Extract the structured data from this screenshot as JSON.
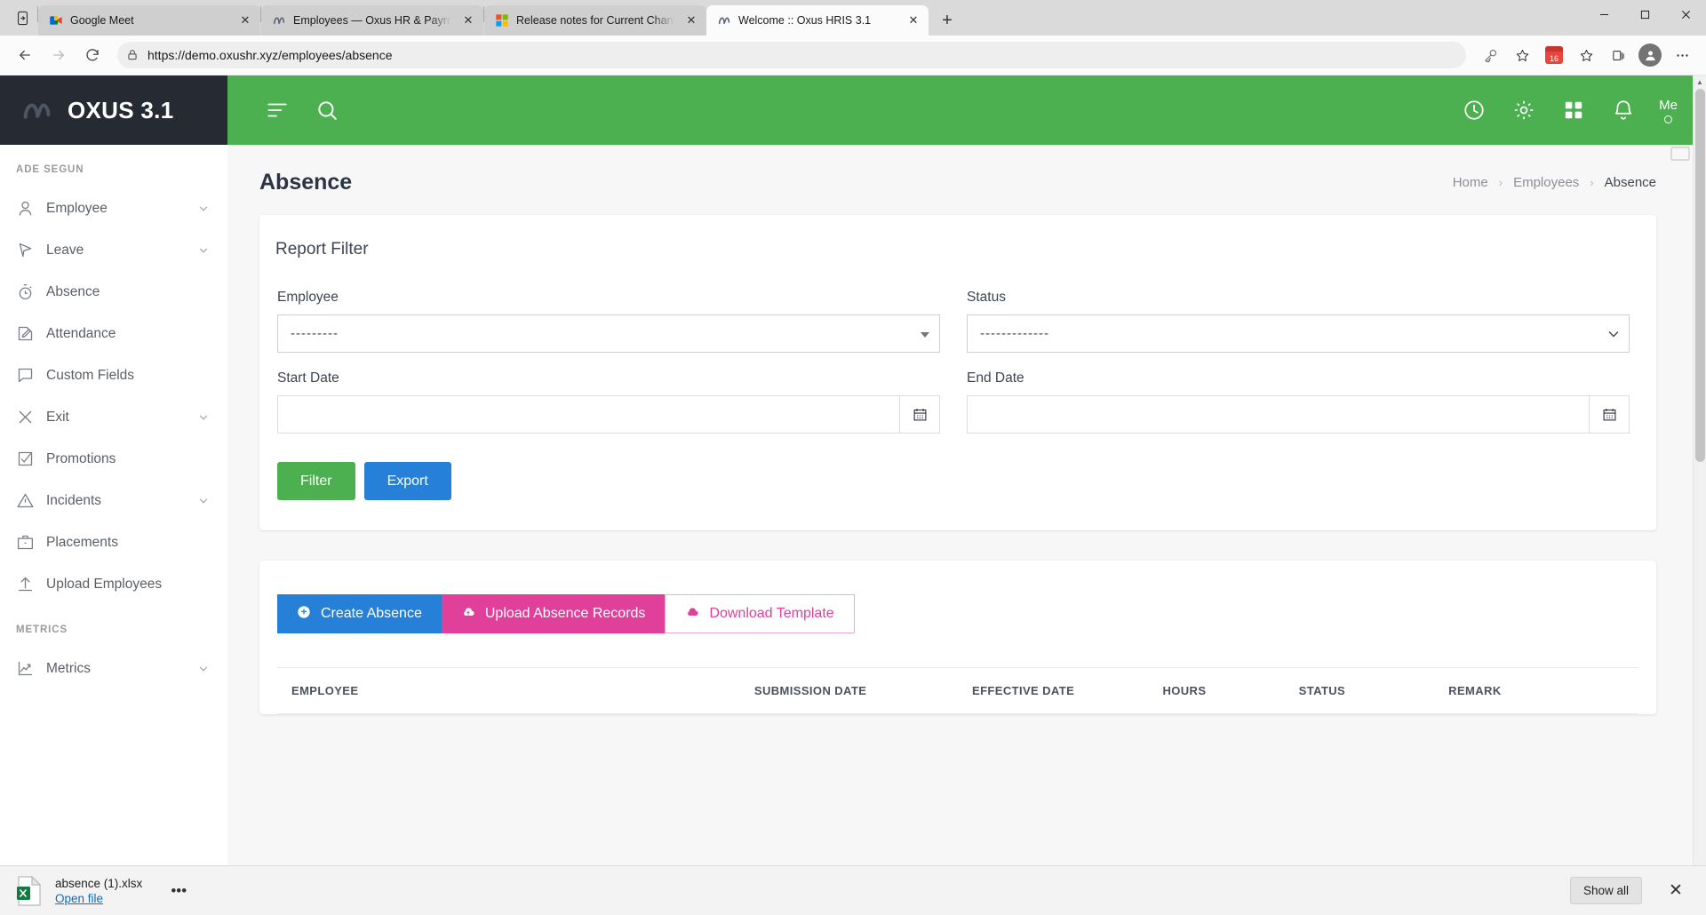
{
  "browser": {
    "tabs": [
      {
        "title": "Google Meet",
        "favicon": "meet-icon",
        "active": false
      },
      {
        "title": "Employees — Oxus HR & Payroll",
        "favicon": "oxus-icon",
        "active": false
      },
      {
        "title": "Release notes for Current Chann",
        "favicon": "microsoft-icon",
        "active": false
      },
      {
        "title": "Welcome :: Oxus HRIS 3.1",
        "favicon": "oxus-icon",
        "active": true
      }
    ],
    "new_tab_label": "+",
    "close_label": "✕",
    "window_controls": {
      "minimize": "minimize-icon",
      "maximize": "maximize-icon",
      "close": "close-icon"
    },
    "toolbar": {
      "back": "back-arrow-icon",
      "forward": "forward-arrow-icon",
      "reload": "reload-icon",
      "lock": "lock-icon",
      "url_scheme": "https://",
      "url_host": "demo.oxushr.xyz",
      "url_path": "/employees/absence",
      "url_full": "https://demo.oxushr.xyz/employees/absence",
      "icons": [
        "key-icon",
        "favorite-star-icon",
        "calendar-badge-icon",
        "collections-icon",
        "browser-essentials-icon",
        "profile-icon",
        "settings-more-icon"
      ],
      "calendar_badge_number": "16"
    }
  },
  "app": {
    "brand": "OXUS 3.1",
    "brand_mark": "oxus-logo-icon",
    "topbar_icons": [
      "menu-toggle-icon",
      "search-icon",
      "history-clock-icon",
      "settings-gear-icon",
      "apps-grid-icon",
      "notifications-bell-icon"
    ],
    "user": {
      "label": "Me",
      "status": "online-dot"
    }
  },
  "sidebar": {
    "user_name": "ADE SEGUN",
    "items": [
      {
        "label": "Employee",
        "icon": "user-icon",
        "chevron": true
      },
      {
        "label": "Leave",
        "icon": "flag-icon",
        "chevron": true
      },
      {
        "label": "Absence",
        "icon": "stopwatch-icon",
        "chevron": false
      },
      {
        "label": "Attendance",
        "icon": "edit-note-icon",
        "chevron": false
      },
      {
        "label": "Custom Fields",
        "icon": "comment-icon",
        "chevron": false
      },
      {
        "label": "Exit",
        "icon": "close-x-icon",
        "chevron": true
      },
      {
        "label": "Promotions",
        "icon": "checkbox-icon",
        "chevron": false
      },
      {
        "label": "Incidents",
        "icon": "warning-triangle-icon",
        "chevron": true
      },
      {
        "label": "Placements",
        "icon": "briefcase-icon",
        "chevron": false
      },
      {
        "label": "Upload Employees",
        "icon": "upload-arrow-icon",
        "chevron": false
      }
    ],
    "metrics_section": "METRICS",
    "metrics_items": [
      {
        "label": "Metrics",
        "icon": "trend-chart-icon",
        "chevron": true
      }
    ]
  },
  "page": {
    "title": "Absence",
    "breadcrumb": [
      {
        "label": "Home",
        "current": false
      },
      {
        "label": "Employees",
        "current": false
      },
      {
        "label": "Absence",
        "current": true
      }
    ],
    "breadcrumb_separator": "›"
  },
  "report_filter": {
    "card_title": "Report Filter",
    "employee": {
      "label": "Employee",
      "value": "---------"
    },
    "status": {
      "label": "Status",
      "value": "-------------"
    },
    "start_date": {
      "label": "Start Date",
      "value": "",
      "placeholder": "",
      "button_icon": "calendar-icon"
    },
    "end_date": {
      "label": "End Date",
      "value": "",
      "placeholder": "",
      "button_icon": "calendar-icon"
    },
    "filter_button": "Filter",
    "export_button": "Export"
  },
  "actions": {
    "create_absence": {
      "label": "Create Absence",
      "icon": "plus-circle-icon"
    },
    "upload_records": {
      "label": "Upload Absence Records",
      "icon": "cloud-upload-icon"
    },
    "download_template": {
      "label": "Download Template",
      "icon": "cloud-download-icon"
    }
  },
  "table": {
    "headers": [
      "EMPLOYEE",
      "SUBMISSION DATE",
      "EFFECTIVE DATE",
      "HOURS",
      "STATUS",
      "REMARK"
    ],
    "rows": []
  },
  "download_bar": {
    "file_name": "absence (1).xlsx",
    "open_link": "Open file",
    "more_label": "•••",
    "show_all": "Show all",
    "close_label": "✕",
    "file_icon": "excel-file-icon"
  },
  "colors": {
    "brand_dark": "#262b33",
    "green": "#4caf50",
    "blue": "#2680d8",
    "pink": "#e0409a",
    "page_bg": "#f7f7f7",
    "text_dark": "#2b3442"
  }
}
